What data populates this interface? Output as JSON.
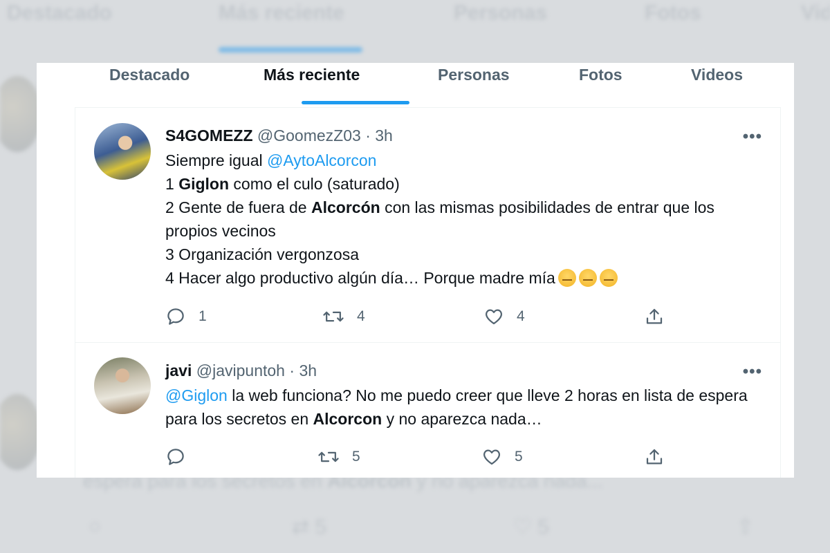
{
  "tabs": [
    {
      "label": "Destacado",
      "active": false
    },
    {
      "label": "Más reciente",
      "active": true
    },
    {
      "label": "Personas",
      "active": false
    },
    {
      "label": "Fotos",
      "active": false
    },
    {
      "label": "Videos",
      "active": false
    }
  ],
  "tweets": [
    {
      "name": "S4GOMEZZ",
      "handle": "@GoomezZ03",
      "dot": "·",
      "time": "3h",
      "more": "•••",
      "lines": {
        "l1a": "Siempre igual ",
        "l1mention": "@AytoAlcorcon",
        "l2a": "1 ",
        "l2bold": "Giglon",
        "l2b": " como el culo (saturado)",
        "l3a": "2 Gente de fuera de ",
        "l3bold": "Alcorcón",
        "l3b": " con las mismas posibilidades de entrar que los propios vecinos",
        "l4": "3 Organización vergonzosa",
        "l5": "4 Hacer algo productivo algún día… Porque madre mía"
      },
      "emojis": [
        "grimacing-face-emoji",
        "confused-face-emoji",
        "confused-face-emoji"
      ],
      "replies": "1",
      "retweets": "4",
      "likes": "4"
    },
    {
      "name": "javi",
      "handle": "@javipuntoh",
      "dot": "·",
      "time": "3h",
      "more": "•••",
      "lines": {
        "mention": "@Giglon",
        "t1": " la web funciona? No me puedo creer que lleve 2 horas en lista de espera para los secretos en ",
        "bold": "Alcorcon",
        "t2": " y no aparezca nada…"
      },
      "replies": "",
      "retweets": "5",
      "likes": "5"
    }
  ],
  "colors": {
    "accent": "#1d9bf0",
    "text_primary": "#0f1419",
    "text_secondary": "#536471"
  }
}
